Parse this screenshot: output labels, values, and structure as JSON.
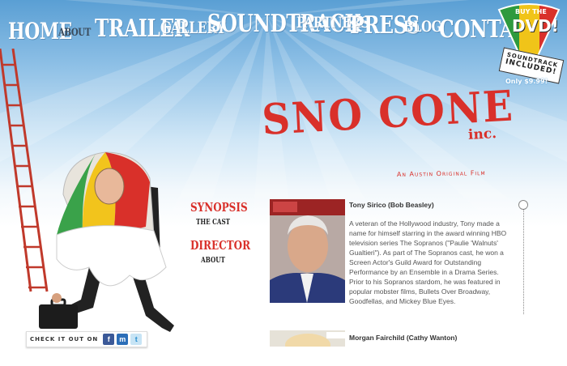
{
  "nav": {
    "items": [
      {
        "label": "HOME",
        "active": false
      },
      {
        "label": "ABOUT",
        "active": true
      },
      {
        "label": "TRAILER",
        "active": false
      },
      {
        "label": "GALLERY",
        "active": false
      },
      {
        "label": "SOUNDTRACK",
        "active": false
      },
      {
        "label": "PARTNERS",
        "active": false
      },
      {
        "label": "PRESS",
        "active": false
      },
      {
        "label": "BLOG",
        "active": false
      },
      {
        "label": "CONTACT",
        "active": false
      }
    ]
  },
  "dvd_badge": {
    "line1": "BUY THE",
    "line2": "DVD!",
    "soundtrack_line1": "SOUNDTRACK",
    "soundtrack_line2": "INCLUDED!",
    "price": "Only $9.99!"
  },
  "hero": {
    "title": "SNO CONE",
    "title_suffix": "inc.",
    "tagline": "An Austin Original Film"
  },
  "side_menu": {
    "items": [
      {
        "label": "SYNOPSIS",
        "size": "big"
      },
      {
        "label": "THE CAST",
        "size": "small"
      },
      {
        "label": "DIRECTOR",
        "size": "big"
      },
      {
        "label": "ABOUT",
        "size": "small"
      }
    ]
  },
  "cast": [
    {
      "name": "Tony Sirico (Bob Beasley)",
      "bio": "A veteran of the Hollywood industry, Tony made a name for himself starring in the award winning HBO television series The Sopranos (\"Paulie 'Walnuts' Gualtieri\").  As part of The Sopranos cast, he won a Screen Actor's Guild Award for Outstanding Performance by an Ensemble in a Drama Series. Prior to his Sopranos stardom, he was featured in popular mobster films, Bullets Over Broadway, Goodfellas, and Mickey Blue Eyes."
    },
    {
      "name": "Morgan Fairchild (Cathy Wanton)",
      "bio": ""
    }
  ],
  "social": {
    "label": "CHECK IT OUT ON",
    "icons": [
      {
        "name": "facebook-icon",
        "glyph": "f"
      },
      {
        "name": "myspace-icon",
        "glyph": "m"
      },
      {
        "name": "twitter-icon",
        "glyph": "t"
      }
    ]
  },
  "colors": {
    "accent_red": "#d9302a",
    "sky_blue": "#5a9fd4",
    "text_gray": "#555555"
  }
}
